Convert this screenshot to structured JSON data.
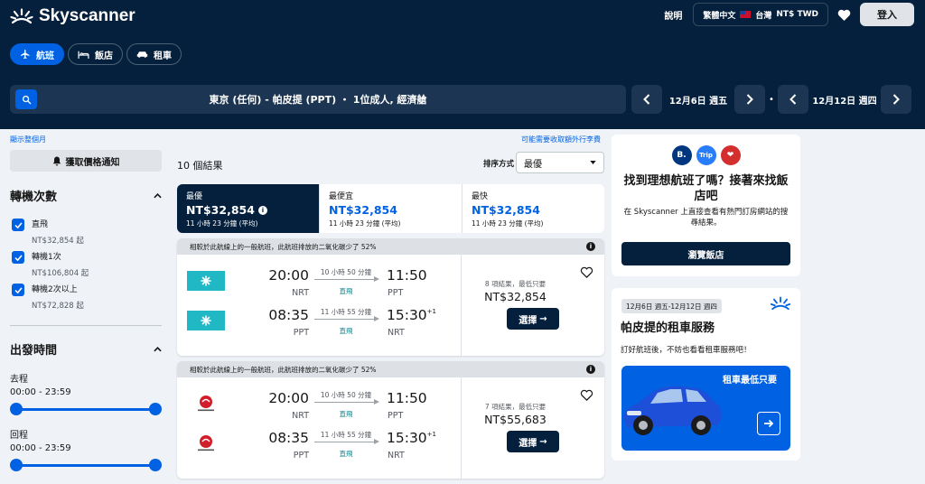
{
  "brand": {
    "name": "Skyscanner"
  },
  "header": {
    "help": "說明",
    "language": "繁體中文",
    "region": "台灣",
    "currency": "NT$ TWD",
    "login": "登入"
  },
  "tabs": [
    {
      "label": "航班",
      "icon": "plane-icon"
    },
    {
      "label": "飯店",
      "icon": "bed-icon"
    },
    {
      "label": "租車",
      "icon": "car-icon"
    }
  ],
  "search": {
    "summary": "東京 (任何) - 帕皮提 (PPT) ・ 1位成人, 經濟艙",
    "depart_date": "12月6日 週五",
    "return_date": "12月12日 週四"
  },
  "links": {
    "show_month": "顯示整個月",
    "baggage_fee": "可能需要收取額外行李費"
  },
  "sidebar": {
    "alert_button": "獲取價格通知",
    "stops_title": "轉機次數",
    "stops": [
      {
        "label": "直飛",
        "sub": "NT$32,854 起"
      },
      {
        "label": "轉機1次",
        "sub": "NT$106,804 起"
      },
      {
        "label": "轉機2次以上",
        "sub": "NT$72,828 起"
      }
    ],
    "times_title": "出發時間",
    "outbound_label": "去程",
    "outbound_range": "00:00 - 23:59",
    "return_label": "回程",
    "return_range": "00:00 - 23:59"
  },
  "results": {
    "count": "10 個結果",
    "sort_label": "排序方式",
    "sort_value": "最優",
    "sort_tabs": [
      {
        "label": "最優",
        "price": "NT$32,854",
        "duration": "11 小時 23 分鐘 (平均)"
      },
      {
        "label": "最便宜",
        "price": "NT$32,854",
        "duration": "11 小時 23 分鐘 (平均)"
      },
      {
        "label": "最快",
        "price": "NT$32,854",
        "duration": "11 小時 23 分鐘 (平均)"
      }
    ],
    "cards": [
      {
        "eco": "相較於此航線上的一般航班，此航班排放的二氧化碳少了 52%",
        "airline": "Air Tahiti Nui",
        "legs": [
          {
            "dep_time": "20:00",
            "dep_code": "NRT",
            "duration": "10 小時 50 分鐘",
            "stops": "直飛",
            "arr_time": "11:50",
            "arr_code": "PPT",
            "next_day": ""
          },
          {
            "dep_time": "08:35",
            "dep_code": "PPT",
            "duration": "11 小時 55 分鐘",
            "stops": "直飛",
            "arr_time": "15:30",
            "arr_code": "NRT",
            "next_day": "+1"
          }
        ],
        "deals": "8 項結果，最低只要",
        "price": "NT$32,854",
        "select": "選擇"
      },
      {
        "eco": "相較於此航線上的一般航班，此航班排放的二氧化碳少了 52%",
        "airline": "Japan Airlines",
        "legs": [
          {
            "dep_time": "20:00",
            "dep_code": "NRT",
            "duration": "10 小時 50 分鐘",
            "stops": "直飛",
            "arr_time": "11:50",
            "arr_code": "PPT",
            "next_day": ""
          },
          {
            "dep_time": "08:35",
            "dep_code": "PPT",
            "duration": "11 小時 55 分鐘",
            "stops": "直飛",
            "arr_time": "15:30",
            "arr_code": "NRT",
            "next_day": "+1"
          }
        ],
        "deals": "7 項結果，最低只要",
        "price": "NT$55,683",
        "select": "選擇"
      }
    ]
  },
  "hotel_panel": {
    "title": "找到理想航班了嗎？接著來找飯店吧",
    "text": "在 Skyscanner 上直接查看有熱門訂房網站的搜尋結果。",
    "button": "瀏覽飯店",
    "icons": [
      "B.",
      "Trip",
      "❤"
    ]
  },
  "car_panel": {
    "dates": "12月6日 週五-12月12日 週四",
    "title": "帕皮提的租車服務",
    "text": "訂好航班後，不妨也看看租車服務吧！",
    "promo": "租車最低只要"
  },
  "colors": {
    "navy": "#05203c",
    "blue": "#0062e3",
    "background": "#eff3f8"
  }
}
